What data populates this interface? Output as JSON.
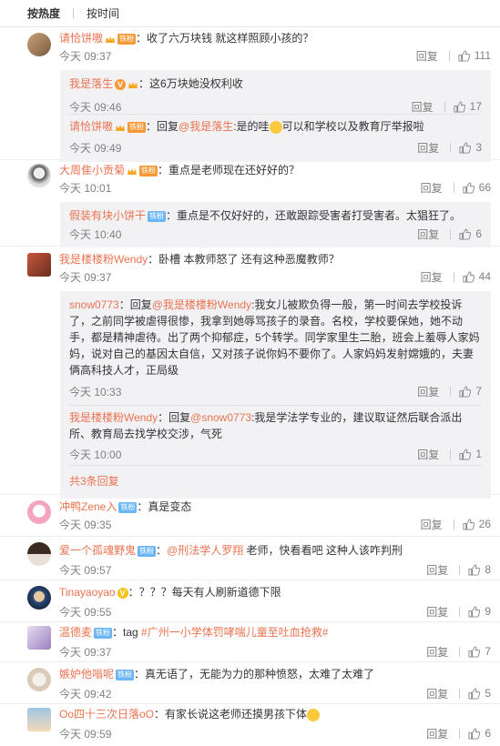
{
  "sort": {
    "hot": "按热度",
    "time": "按时间"
  },
  "reply_label": "回复",
  "comments": [
    {
      "user": "请恰饼嗷",
      "badge": "铁粉",
      "text": "：收了六万块钱 就这样照顾小孩的？",
      "time": "今天 09:37",
      "likes": "111",
      "subs": [
        {
          "user": "我是落生",
          "text": "：这6万块她没权利收",
          "time": "今天 09:46",
          "likes": "17"
        },
        {
          "user": "请恰饼嗷",
          "badge": "铁粉",
          "pre": "：回复",
          "mention": "@我是落生",
          "text": ":是的哇",
          "text2": "可以和学校以及教育厅举报啦",
          "time": "今天 09:49",
          "likes": "3"
        }
      ]
    },
    {
      "user": "大周隹小贡菊",
      "badge": "铁粉",
      "text": "：重点是老师现在还好好的？",
      "time": "今天 10:01",
      "likes": "66",
      "subs": [
        {
          "user": "假装有块小饼干",
          "badge": "铁粉",
          "text": "：重点是不仅好好的，还敢跟踪受害者打受害者。太猖狂了。",
          "time": "今天 10:40",
          "likes": "6"
        }
      ]
    },
    {
      "user": "我是楼楼粉Wendy",
      "text": "：卧槽 本教师怒了 还有这种恶魔教师？",
      "time": "今天 09:37",
      "likes": "44",
      "subs": [
        {
          "user": "snow0773",
          "pre": "：回复",
          "mention": "@我是楼楼粉Wendy",
          "text": ":我女儿被欺负得一般，第一时间去学校投诉了，之前同学被虐得很惨，我拿到她辱骂孩子的录音。名校，学校要保她，她不动手，都是精神虐待。出了两个抑郁症，5个转学。同学家里生二胎，班会上羞辱人家妈妈，说对自己的基因太自信，又对孩子说你妈不要你了。人家妈妈发射嫦娥的，夫妻俩高科技人才，正局级",
          "time": "今天 10:33",
          "likes": "7"
        },
        {
          "user": "我是楼楼粉Wendy",
          "pre": "：回复",
          "mention": "@snow0773",
          "text": ":我是学法学专业的，建议取证然后联合派出所、教育局去找学校交涉，气死",
          "time": "今天 10:00",
          "likes": "1"
        }
      ],
      "more": "共3条回复"
    },
    {
      "user": "冲鸭Zene入",
      "badge": "铁粉",
      "text": "：真是变态",
      "time": "今天 09:35",
      "likes": "26"
    },
    {
      "user": "爱一个孤魂野鬼",
      "badge": "铁粉",
      "pre": "：",
      "mention": "@刑法学人罗翔",
      "text": " 老师，快看看吧 这种人该咋判刑",
      "time": "今天 09:57",
      "likes": "8"
    },
    {
      "user": "Tinayaoyao",
      "text": "：？？？每天有人刷新道德下限",
      "time": "今天 09:55",
      "likes": "9"
    },
    {
      "user": "温德麦",
      "badge": "铁粉",
      "pre": "：tag ",
      "mention": "#广州一小学体罚哮喘儿童至吐血抢救#",
      "text": "",
      "time": "今天 09:37",
      "likes": "7"
    },
    {
      "user": "嫉妒他嗡呢",
      "badge": "铁粉",
      "text": "：真无语了，无能为力的那种愤怒，太难了太难了",
      "time": "今天 09:42",
      "likes": "5"
    },
    {
      "user": "Oo四十三次日落oO",
      "text": "：有家长说这老师还摸男孩下体",
      "time": "今天 09:59",
      "likes": "6"
    }
  ]
}
